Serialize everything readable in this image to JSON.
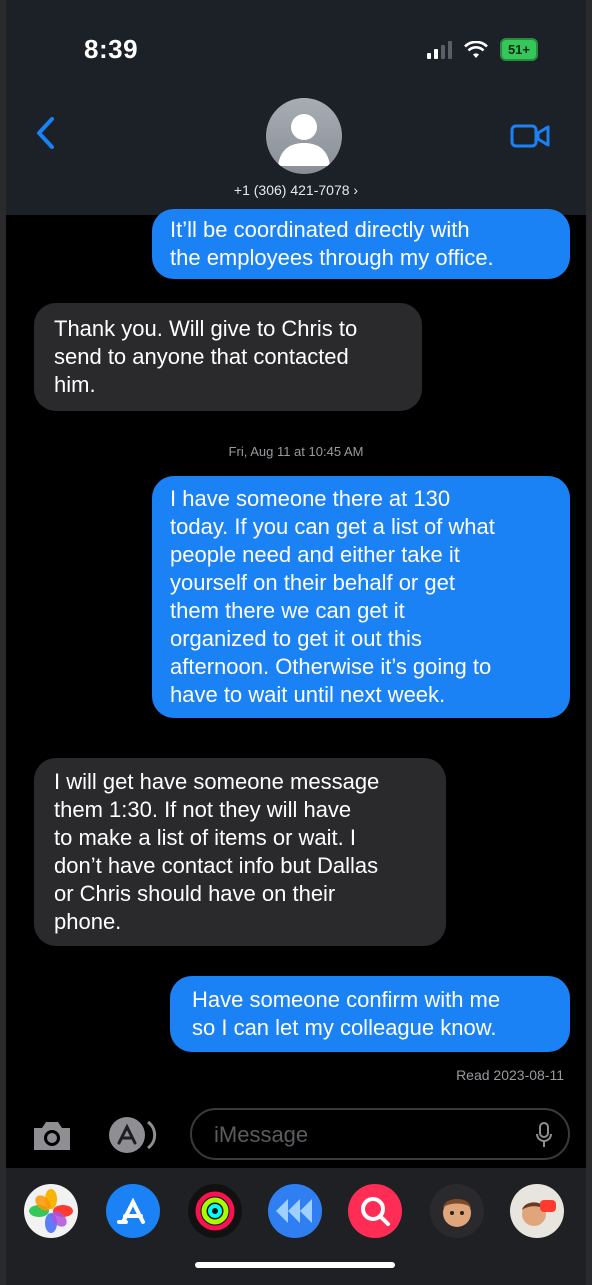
{
  "status_bar": {
    "time": "8:39",
    "battery": "51+"
  },
  "header": {
    "contact_label": "+1 (306) 421-7078 ›"
  },
  "messages": [
    {
      "direction": "out",
      "lines": [
        "It’ll be coordinated directly with",
        "the employees through my office."
      ]
    },
    {
      "direction": "in",
      "lines": [
        "Thank you. Will give to Chris to",
        "send to anyone that contacted",
        "him."
      ]
    },
    {
      "direction": "out",
      "lines": [
        "I have someone there at 130",
        "today. If you can get a list of what",
        "people need and either take it",
        "yourself on their behalf or get",
        "them there we can get it",
        "organized to get it out this",
        "afternoon. Otherwise it’s going to",
        "have to wait until next week."
      ]
    },
    {
      "direction": "in",
      "lines": [
        "I will get have someone message",
        "them 1:30.   If not they will have",
        "to make a list of items or wait.   I",
        "don’t have contact info but Dallas",
        "or Chris should have on their",
        "phone."
      ]
    },
    {
      "direction": "out",
      "lines": [
        "Have someone confirm with me",
        "so I can let my colleague know."
      ]
    }
  ],
  "timestamp_separator": "Fri, Aug 11 at 10:45 AM",
  "read_receipt": "Read 2023-08-11",
  "input": {
    "placeholder": "iMessage"
  },
  "app_drawer": [
    "photos",
    "app-store",
    "activity",
    "audio-message",
    "search-images",
    "memoji",
    "memoji-stickers"
  ],
  "colors": {
    "outgoing": "#1a82f5",
    "incoming": "#2a2a2d",
    "accent": "#1a82f5"
  }
}
